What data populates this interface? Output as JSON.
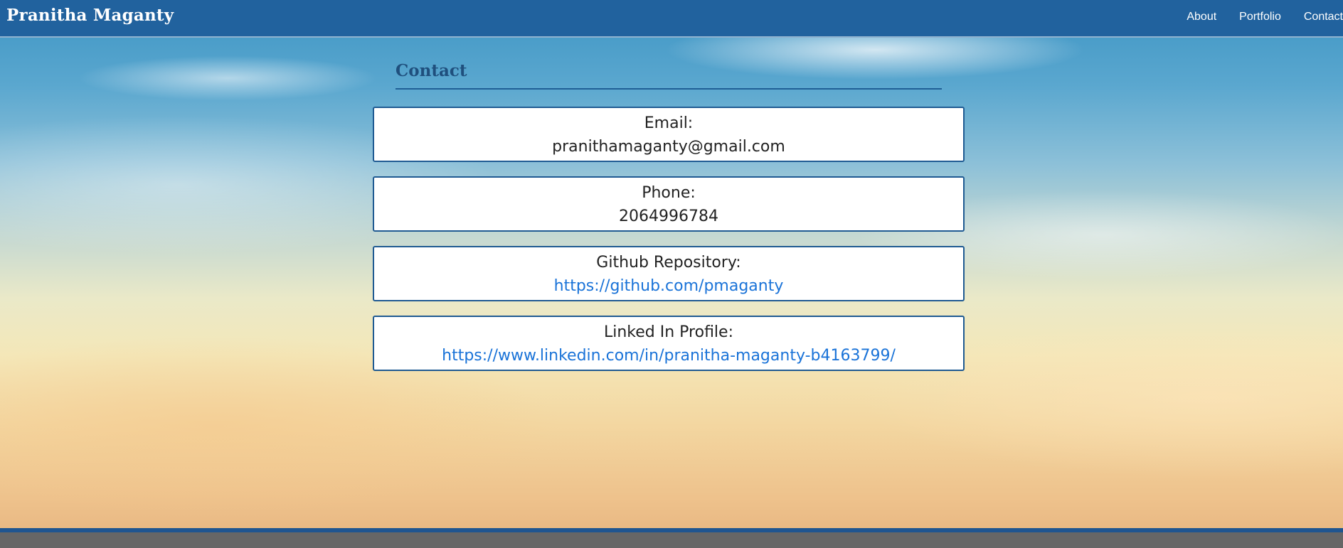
{
  "header": {
    "brand": "Pranitha Maganty",
    "nav": [
      {
        "label": "About"
      },
      {
        "label": "Portfolio"
      },
      {
        "label": "Contact"
      }
    ]
  },
  "contact": {
    "title": "Contact",
    "cards": [
      {
        "label": "Email:",
        "value": "pranithamaganty@gmail.com"
      },
      {
        "label": "Phone:",
        "value": "2064996784"
      },
      {
        "label": "Github Repository:",
        "value": "https://github.com/pmaganty"
      },
      {
        "label": "Linked In Profile:",
        "value": "https://www.linkedin.com/in/pranitha-maganty-b4163799/"
      }
    ]
  },
  "colors": {
    "navbar": "#21629e",
    "accent": "#1f5a92",
    "link": "#1a73d8",
    "footer": "#666666"
  }
}
